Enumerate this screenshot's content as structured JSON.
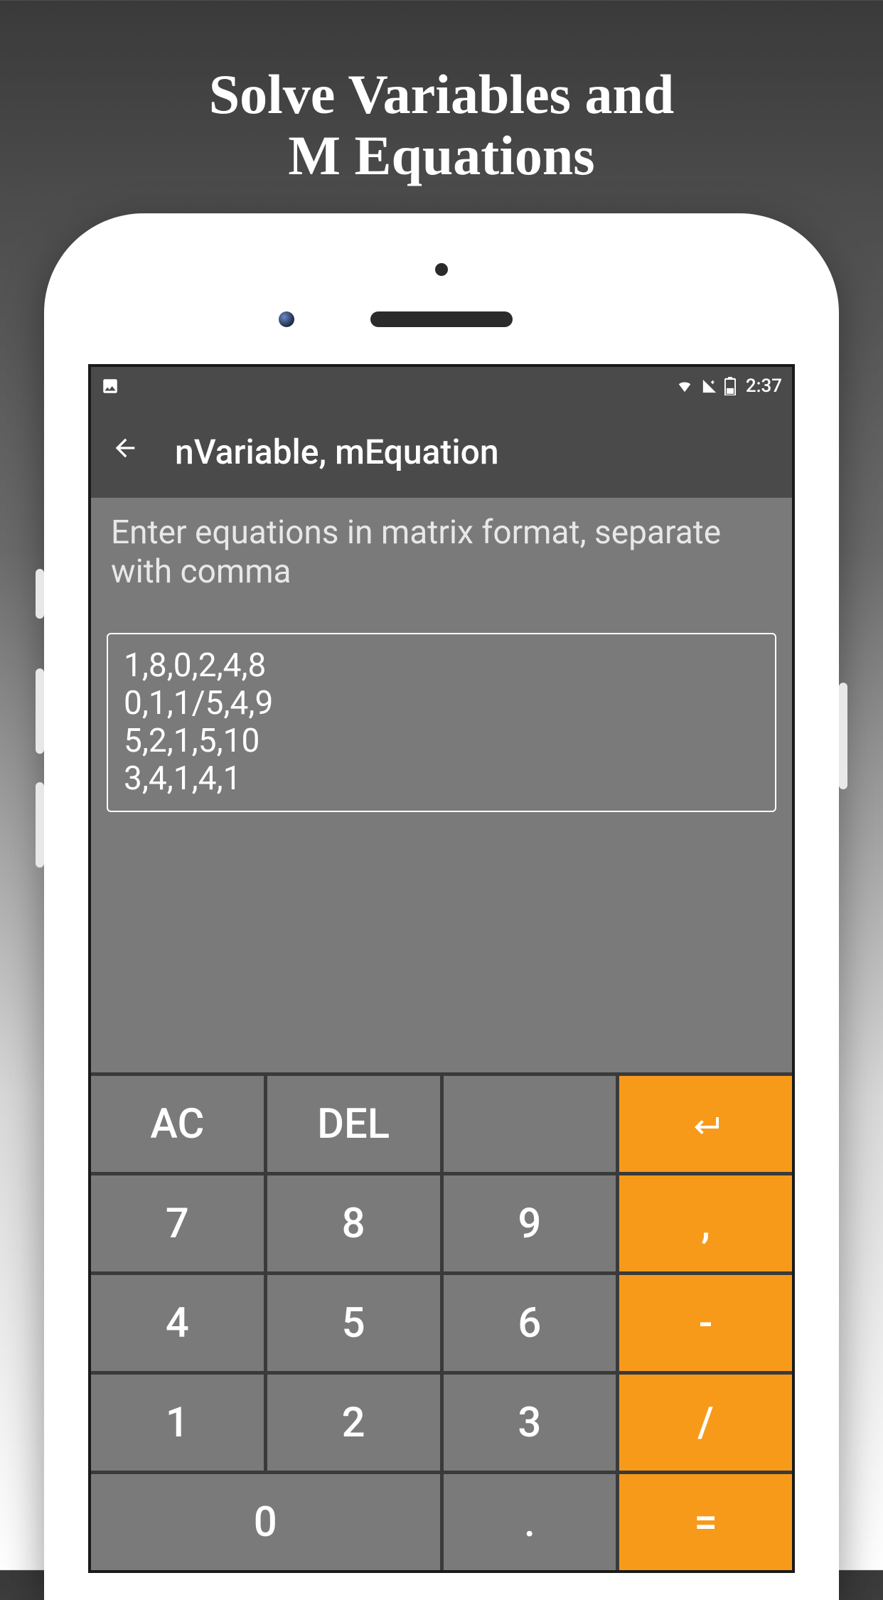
{
  "promo": {
    "title_line1": "Solve Variables and",
    "title_line2": "M Equations"
  },
  "status_bar": {
    "time": "2:37"
  },
  "app_bar": {
    "title": "nVariable, mEquation"
  },
  "instruction": "Enter equations in matrix format, separate with comma",
  "input_value": "1,8,0,2,4,8\n0,1,1/5,4,9\n5,2,1,5,10\n3,4,1,4,1",
  "keypad": {
    "ac": "AC",
    "del": "DEL",
    "comma": ",",
    "minus": "-",
    "divide": "/",
    "equals": "=",
    "dot": ".",
    "d7": "7",
    "d8": "8",
    "d9": "9",
    "d4": "4",
    "d5": "5",
    "d6": "6",
    "d1": "1",
    "d2": "2",
    "d3": "3",
    "d0": "0"
  }
}
